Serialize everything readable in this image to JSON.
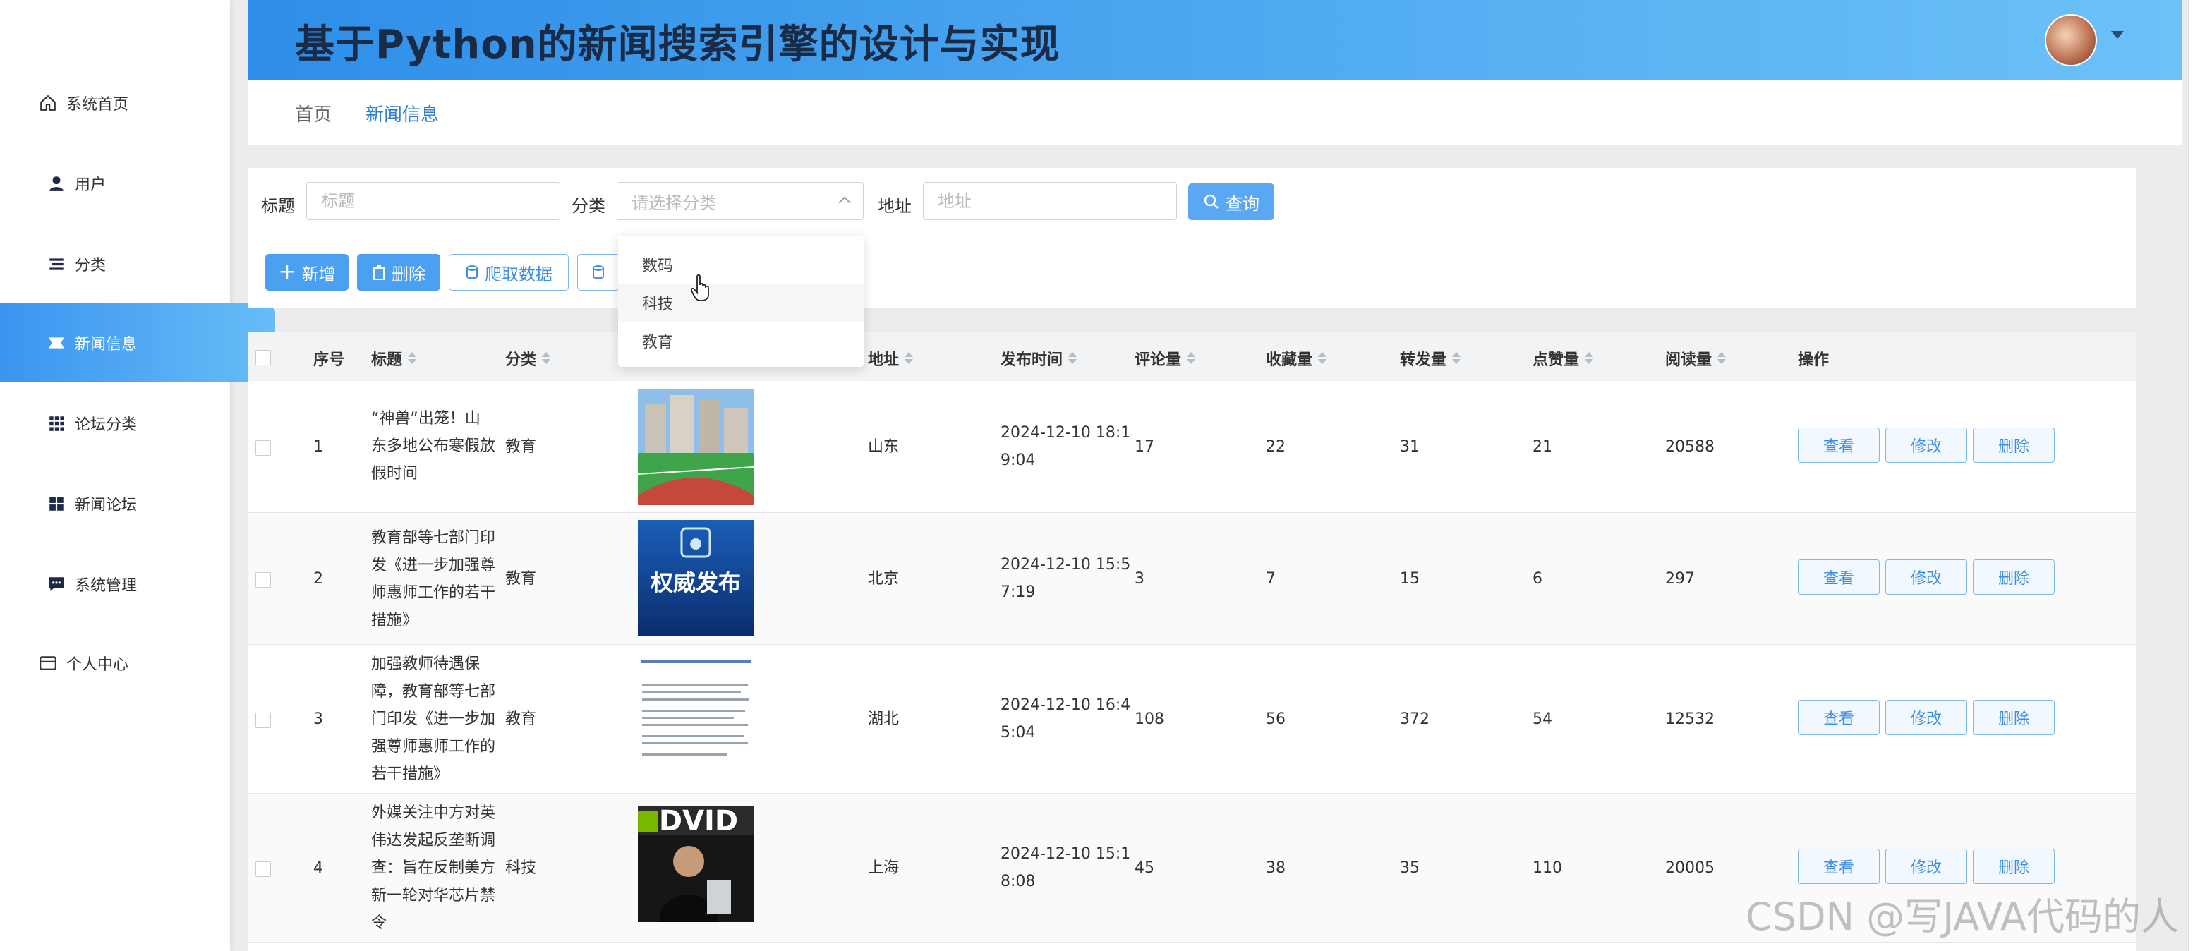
{
  "app_title": "基于Python的新闻搜索引擎的设计与实现",
  "sidebar": {
    "items": [
      {
        "label": "系统首页",
        "icon": "home-icon"
      },
      {
        "label": "用户",
        "icon": "user-icon"
      },
      {
        "label": "分类",
        "icon": "list-icon"
      },
      {
        "label": "新闻信息",
        "icon": "news-icon",
        "active": true
      },
      {
        "label": "论坛分类",
        "icon": "grid-icon"
      },
      {
        "label": "新闻论坛",
        "icon": "apps-icon"
      },
      {
        "label": "系统管理",
        "icon": "chat-icon"
      },
      {
        "label": "个人中心",
        "icon": "card-icon"
      }
    ]
  },
  "breadcrumb": {
    "home": "首页",
    "current": "新闻信息"
  },
  "search": {
    "title_label": "标题",
    "title_placeholder": "标题",
    "category_label": "分类",
    "category_placeholder": "请选择分类",
    "address_label": "地址",
    "address_placeholder": "地址",
    "query_button": "查询"
  },
  "toolbar": {
    "add": "新增",
    "delete": "删除",
    "crawl": "爬取数据"
  },
  "dropdown": {
    "options": [
      "数码",
      "科技",
      "教育"
    ],
    "hovered": "科技"
  },
  "table": {
    "columns": [
      "序号",
      "标题",
      "分类",
      "地址",
      "发布时间",
      "评论量",
      "收藏量",
      "转发量",
      "点赞量",
      "阅读量",
      "操作"
    ],
    "actions": {
      "view": "查看",
      "edit": "修改",
      "delete": "删除"
    },
    "rows": [
      {
        "index": "1",
        "title": [
          "“神兽”出笼！山",
          "东多地公布寒假放",
          "假时间"
        ],
        "category": "教育",
        "address": "山东",
        "time": [
          "2024-12-10 18:1",
          "9:04"
        ],
        "comments": "17",
        "favorites": "22",
        "shares": "31",
        "likes": "21",
        "reads": "20588",
        "thumb": "building"
      },
      {
        "index": "2",
        "title": [
          "教育部等七部门印",
          "发《进一步加强尊",
          "师惠师工作的若干",
          "措施》"
        ],
        "category": "教育",
        "address": "北京",
        "time": [
          "2024-12-10 15:5",
          "7:19"
        ],
        "comments": "3",
        "favorites": "7",
        "shares": "15",
        "likes": "6",
        "reads": "297",
        "thumb": "authority",
        "thumb_text": "权威发布"
      },
      {
        "index": "3",
        "title": [
          "加强教师待遇保",
          "障，教育部等七部",
          "门印发《进一步加",
          "强尊师惠师工作的",
          "若干措施》"
        ],
        "category": "教育",
        "address": "湖北",
        "time": [
          "2024-12-10 16:4",
          "5:04"
        ],
        "comments": "108",
        "favorites": "56",
        "shares": "372",
        "likes": "54",
        "reads": "12532",
        "thumb": "document"
      },
      {
        "index": "4",
        "title": [
          "外媒关注中方对英",
          "伟达发起反垄断调",
          "查：旨在反制美方",
          "新一轮对华芯片禁",
          "令"
        ],
        "category": "科技",
        "address": "上海",
        "time": [
          "2024-12-10 15:1",
          "8:08"
        ],
        "comments": "45",
        "favorites": "38",
        "shares": "35",
        "likes": "110",
        "reads": "20005",
        "thumb": "nvidia",
        "thumb_text": "DVID"
      }
    ]
  },
  "watermark": "CSDN @写JAVA代码的人"
}
